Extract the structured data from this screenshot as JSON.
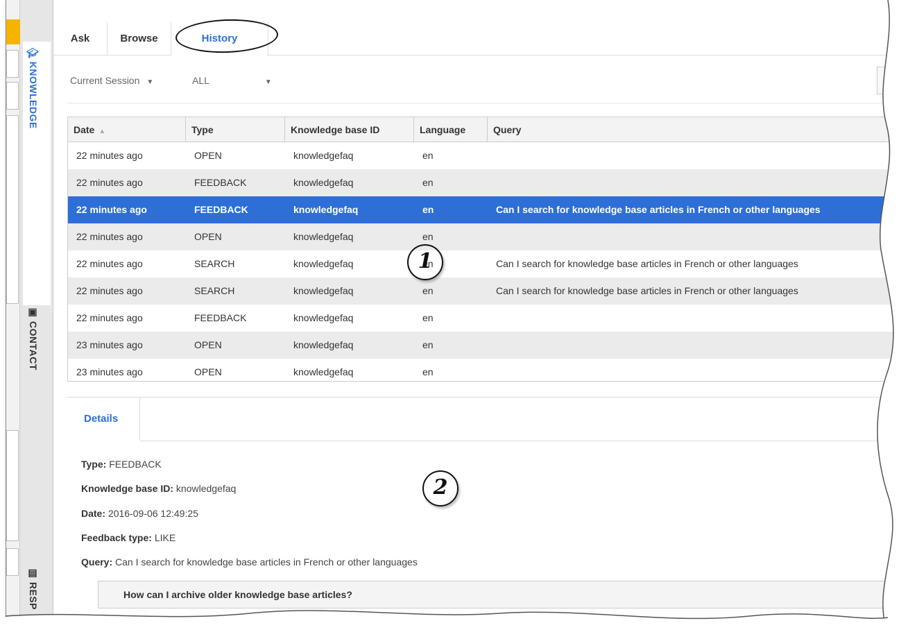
{
  "rail": {
    "knowledge_label": "KNOWLEDGE",
    "contact_label": "CONTACT",
    "resp_label": "RESP"
  },
  "tabs": {
    "ask": "Ask",
    "browse": "Browse",
    "history": "History"
  },
  "filters": {
    "session": "Current Session",
    "type": "ALL"
  },
  "table": {
    "columns": [
      "Date",
      "Type",
      "Knowledge base ID",
      "Language",
      "Query"
    ],
    "rows": [
      {
        "date": "22 minutes ago",
        "type": "OPEN",
        "kb": "knowledgefaq",
        "lang": "en",
        "query": ""
      },
      {
        "date": "22 minutes ago",
        "type": "FEEDBACK",
        "kb": "knowledgefaq",
        "lang": "en",
        "query": ""
      },
      {
        "date": "22 minutes ago",
        "type": "FEEDBACK",
        "kb": "knowledgefaq",
        "lang": "en",
        "query": "Can I search for knowledge base articles in French or other languages"
      },
      {
        "date": "22 minutes ago",
        "type": "OPEN",
        "kb": "knowledgefaq",
        "lang": "en",
        "query": ""
      },
      {
        "date": "22 minutes ago",
        "type": "SEARCH",
        "kb": "knowledgefaq",
        "lang": "en",
        "query": "Can I search for knowledge base articles in French or other languages"
      },
      {
        "date": "22 minutes ago",
        "type": "SEARCH",
        "kb": "knowledgefaq",
        "lang": "en",
        "query": "Can I search for knowledge base articles in French or other languages"
      },
      {
        "date": "22 minutes ago",
        "type": "FEEDBACK",
        "kb": "knowledgefaq",
        "lang": "en",
        "query": ""
      },
      {
        "date": "23 minutes ago",
        "type": "OPEN",
        "kb": "knowledgefaq",
        "lang": "en",
        "query": ""
      },
      {
        "date": "23 minutes ago",
        "type": "OPEN",
        "kb": "knowledgefaq",
        "lang": "en",
        "query": ""
      }
    ],
    "selected_row": 2
  },
  "annotations": {
    "one": "1",
    "two": "2"
  },
  "details": {
    "tab": "Details",
    "type_label": "Type:",
    "type_value": "FEEDBACK",
    "kb_label": "Knowledge base ID:",
    "kb_value": "knowledgefaq",
    "date_label": "Date:",
    "date_value": "2016-09-06 12:49:25",
    "feedback_label": "Feedback type:",
    "feedback_value": "LIKE",
    "query_label": "Query:",
    "query_value": "Can I search for knowledge base articles in French or other languages",
    "accordion": "How can I archive older knowledge base articles?"
  },
  "colors": {
    "accent": "#2d6fd6",
    "selection": "#2d6fd6",
    "highlight": "#f5b400"
  }
}
